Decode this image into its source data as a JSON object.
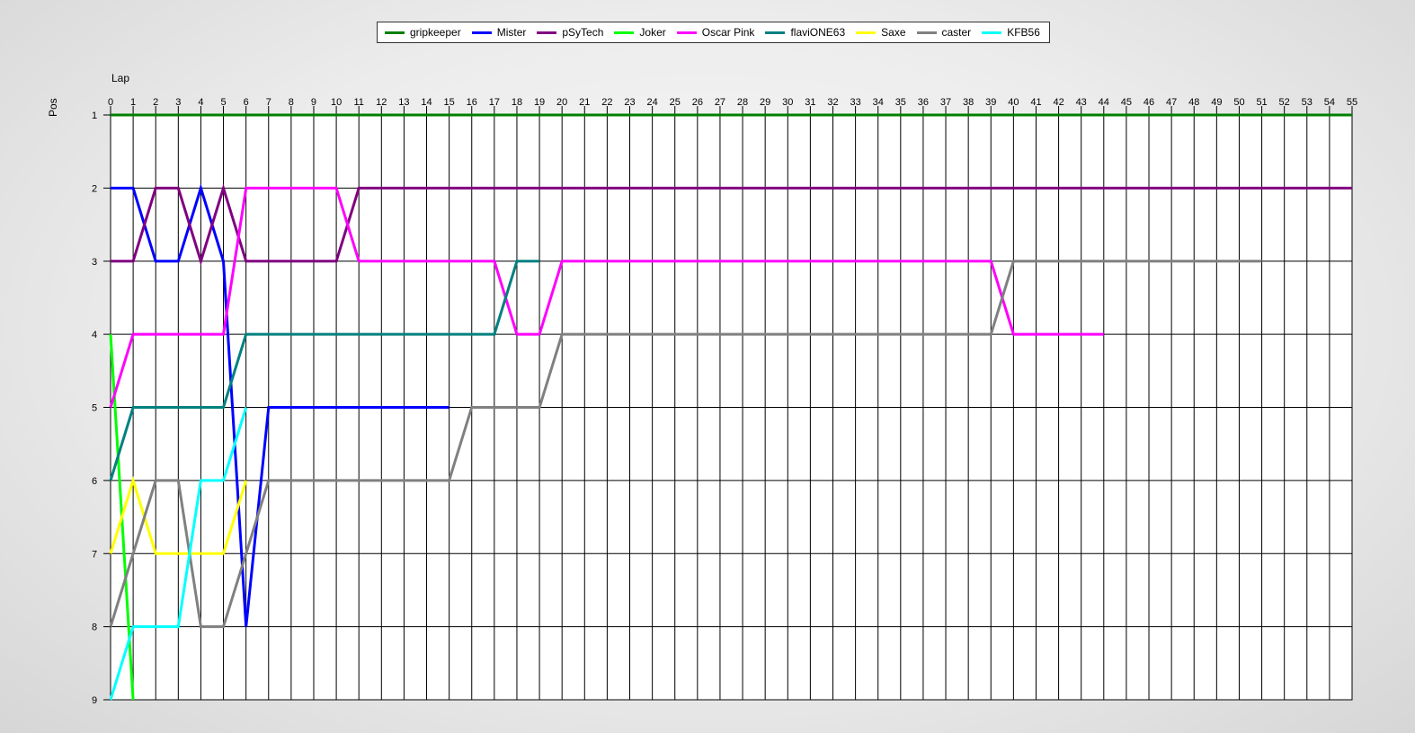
{
  "chart_data": {
    "type": "line",
    "xlabel": "Lap",
    "ylabel": "Pos",
    "xlim": [
      0,
      55
    ],
    "ylim": [
      1,
      9
    ],
    "y_inverted": true,
    "x_ticks": [
      0,
      1,
      2,
      3,
      4,
      5,
      6,
      7,
      8,
      9,
      10,
      11,
      12,
      13,
      14,
      15,
      16,
      17,
      18,
      19,
      20,
      21,
      22,
      23,
      24,
      25,
      26,
      27,
      28,
      29,
      30,
      31,
      32,
      33,
      34,
      35,
      36,
      37,
      38,
      39,
      40,
      41,
      42,
      43,
      44,
      45,
      46,
      47,
      48,
      49,
      50,
      51,
      52,
      53,
      54,
      55
    ],
    "y_ticks": [
      1,
      2,
      3,
      4,
      5,
      6,
      7,
      8,
      9
    ],
    "grid": true,
    "legend_position": "top-center",
    "series": [
      {
        "name": "gripkeeper",
        "color": "#008000",
        "points": [
          [
            0,
            1
          ],
          [
            55,
            1
          ]
        ]
      },
      {
        "name": "Mister",
        "color": "#0000ff",
        "points": [
          [
            0,
            2
          ],
          [
            1,
            2
          ],
          [
            2,
            3
          ],
          [
            3,
            3
          ],
          [
            4,
            2
          ],
          [
            5,
            3
          ],
          [
            6,
            8
          ],
          [
            7,
            5
          ],
          [
            15,
            5
          ]
        ]
      },
      {
        "name": "pSyTech",
        "color": "#800080",
        "points": [
          [
            0,
            3
          ],
          [
            1,
            3
          ],
          [
            2,
            2
          ],
          [
            3,
            2
          ],
          [
            4,
            3
          ],
          [
            5,
            2
          ],
          [
            6,
            3
          ],
          [
            10,
            3
          ],
          [
            11,
            2
          ],
          [
            55,
            2
          ]
        ]
      },
      {
        "name": "Joker",
        "color": "#00ff00",
        "points": [
          [
            0,
            4
          ],
          [
            1,
            9
          ]
        ]
      },
      {
        "name": "Oscar Pink",
        "color": "#ff00ff",
        "points": [
          [
            0,
            5
          ],
          [
            1,
            4
          ],
          [
            5,
            4
          ],
          [
            6,
            2
          ],
          [
            10,
            2
          ],
          [
            11,
            3
          ],
          [
            17,
            3
          ],
          [
            18,
            4
          ],
          [
            19,
            4
          ],
          [
            20,
            3
          ],
          [
            39,
            3
          ],
          [
            40,
            4
          ],
          [
            44,
            4
          ]
        ]
      },
      {
        "name": "flaviONE63",
        "color": "#008080",
        "points": [
          [
            0,
            6
          ],
          [
            1,
            5
          ],
          [
            5,
            5
          ],
          [
            6,
            4
          ],
          [
            17,
            4
          ],
          [
            18,
            3
          ],
          [
            19,
            3
          ]
        ]
      },
      {
        "name": "Saxe",
        "color": "#ffff00",
        "points": [
          [
            0,
            7
          ],
          [
            1,
            6
          ],
          [
            2,
            7
          ],
          [
            5,
            7
          ],
          [
            6,
            6
          ]
        ]
      },
      {
        "name": "caster",
        "color": "#808080",
        "points": [
          [
            0,
            8
          ],
          [
            1,
            7
          ],
          [
            2,
            6
          ],
          [
            3,
            6
          ],
          [
            4,
            8
          ],
          [
            5,
            8
          ],
          [
            6,
            7
          ],
          [
            7,
            6
          ],
          [
            15,
            6
          ],
          [
            16,
            5
          ],
          [
            19,
            5
          ],
          [
            20,
            4
          ],
          [
            39,
            4
          ],
          [
            40,
            3
          ],
          [
            51,
            3
          ]
        ]
      },
      {
        "name": "KFB56",
        "color": "#00ffff",
        "points": [
          [
            0,
            9
          ],
          [
            1,
            8
          ],
          [
            3,
            8
          ],
          [
            4,
            6
          ],
          [
            5,
            6
          ],
          [
            6,
            5
          ]
        ]
      }
    ]
  }
}
